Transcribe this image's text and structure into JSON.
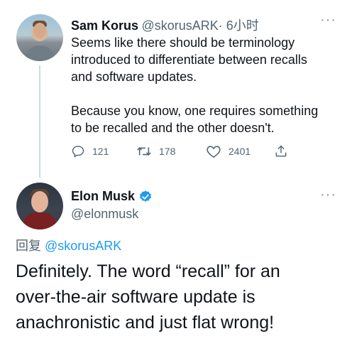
{
  "tweet1": {
    "name": "Sam Korus",
    "handle": "@skorusARK",
    "time": "· 6小时",
    "text_lines": [
      "Seems like there should be terminology",
      "introduced to differentiate between recalls",
      "and software updates.",
      "Because you know, one requires something",
      "to be recalled and the other doesn't."
    ],
    "replies": "121",
    "retweets": "178",
    "likes": "2401"
  },
  "tweet2": {
    "name": "Elon Musk",
    "handle": "@elonmusk",
    "reply_label": "回复",
    "reply_to": "@skorusARK",
    "text_lines": [
      "Definitely. The word “recall” for an",
      "over-the-air software update is",
      "anachronistic and just flat wrong!"
    ]
  },
  "icons": {
    "reply": "reply-icon",
    "retweet": "retweet-icon",
    "like": "heart-icon",
    "share": "share-icon",
    "more": "more-icon",
    "verified": "verified-badge-icon"
  },
  "colors": {
    "accent": "#1d9bf0",
    "secondary_text": "#536471"
  }
}
